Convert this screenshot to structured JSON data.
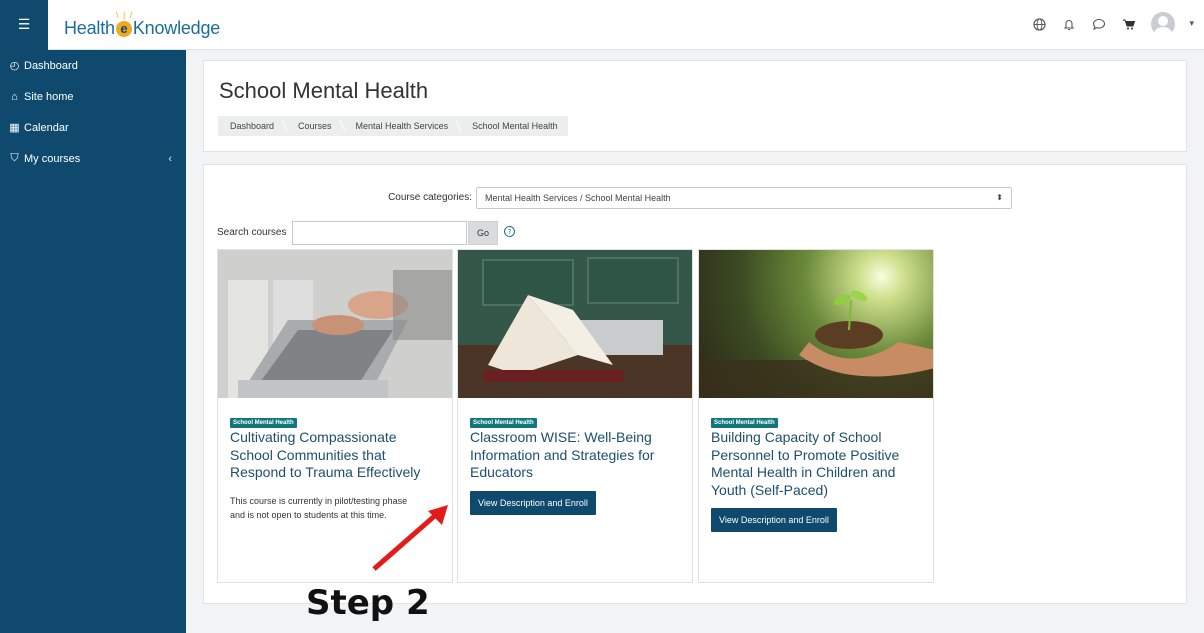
{
  "brand": {
    "part1": "Health",
    "e": "e",
    "part2": "Knowledge"
  },
  "sidebar": {
    "items": [
      {
        "label": "Dashboard",
        "icon": "dashboard-icon"
      },
      {
        "label": "Site home",
        "icon": "home-icon"
      },
      {
        "label": "Calendar",
        "icon": "calendar-icon"
      },
      {
        "label": "My courses",
        "icon": "courses-icon"
      }
    ]
  },
  "header": {
    "title": "School Mental Health",
    "breadcrumbs": [
      "Dashboard",
      "Courses",
      "Mental Health Services",
      "School Mental Health"
    ]
  },
  "filters": {
    "category_label": "Course categories:",
    "category_value": "Mental Health Services / School Mental Health",
    "search_label": "Search courses",
    "search_value": "",
    "go_label": "Go"
  },
  "courses": [
    {
      "tag": "School Mental Health",
      "title": "Cultivating Compassionate School Communities that Respond to Trauma Effectively",
      "note": "This course is currently in pilot/testing phase and is not open to students at this time."
    },
    {
      "tag": "School Mental Health",
      "title": "Classroom WISE: Well-Being Information and Strategies for Educators",
      "button": "View Description and Enroll"
    },
    {
      "tag": "School Mental Health",
      "title": "Building Capacity of School Personnel to Promote Positive Mental Health in Children and Youth (Self-Paced)",
      "button": "View Description and Enroll"
    }
  ],
  "annotation": {
    "label": "Step 2",
    "color": "#e31b1b"
  },
  "colors": {
    "sidebar": "#0f4a6e",
    "tag": "#12767a",
    "title": "#1d4f6e"
  }
}
